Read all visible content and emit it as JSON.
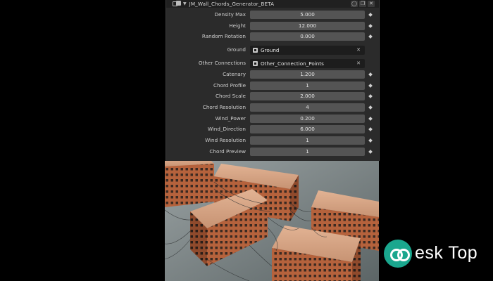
{
  "panel": {
    "title": "JM_Wall_Chords_Generator_BETA",
    "header_buttons": [
      "◯",
      "❐",
      "✕"
    ],
    "properties": [
      {
        "label": "Density Max",
        "value": "5.000",
        "type": "number"
      },
      {
        "label": "Height",
        "value": "12.000",
        "type": "number"
      },
      {
        "label": "Random Rotation",
        "value": "0.000",
        "type": "number"
      },
      {
        "label": "Ground",
        "value": "Ground",
        "type": "object"
      },
      {
        "label": "Other Connections",
        "value": "Other_Connection_Points",
        "type": "object"
      },
      {
        "label": "Catenary",
        "value": "1.200",
        "type": "number"
      },
      {
        "label": "Chord Profile",
        "value": "1",
        "type": "number"
      },
      {
        "label": "Chord Scale",
        "value": "2.000",
        "type": "number"
      },
      {
        "label": "Chord Resolution",
        "value": "4",
        "type": "number"
      },
      {
        "label": "Wind_Power",
        "value": "0.200",
        "type": "number"
      },
      {
        "label": "Wind_Direction",
        "value": "6.000",
        "type": "number"
      },
      {
        "label": "Wind Resolution",
        "value": "1",
        "type": "number"
      },
      {
        "label": "Chord Preview",
        "value": "1",
        "type": "number"
      }
    ],
    "clear_glyph": "✕"
  },
  "watermark": {
    "text": "esk Top"
  },
  "colors": {
    "panel_bg": "#2b2b2b",
    "field_bg": "#545454",
    "object_field_bg": "#1d1d1d",
    "watermark": "#1aa78e"
  }
}
